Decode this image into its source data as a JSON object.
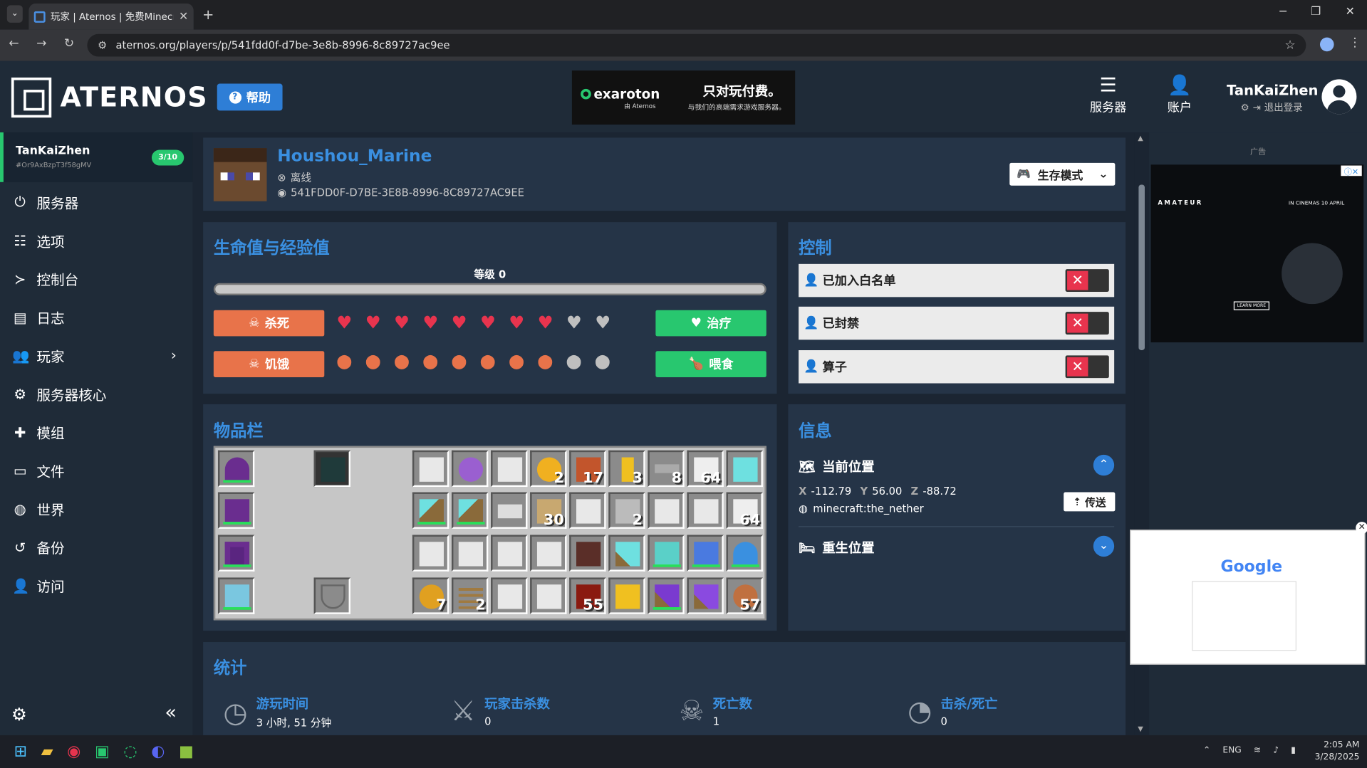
{
  "browser": {
    "tab_title": "玩家 | Aternos | 免费Minecraft服",
    "url": "aternos.org/players/p/541fdd0f-d7be-3e8b-8996-8c89727ac9ee"
  },
  "header": {
    "logo": "ATERNOS",
    "help": "帮助",
    "ad_brand": "exaroton",
    "ad_brand_sub": "由 Aternos",
    "ad_headline": "只对玩付费。",
    "ad_sub": "与我们的高端需求游戏服务器。",
    "nav_servers": "服务器",
    "nav_account": "账户",
    "username": "TanKaiZhen",
    "logout": "退出登录"
  },
  "sidebar": {
    "server_name": "TanKaiZhen",
    "server_id": "#Or9AxBzpT3f58gMV",
    "player_count": "3/10",
    "items": [
      {
        "label": "服务器",
        "icon": "power-icon"
      },
      {
        "label": "选项",
        "icon": "sliders-icon"
      },
      {
        "label": "控制台",
        "icon": "terminal-icon"
      },
      {
        "label": "日志",
        "icon": "file-icon"
      },
      {
        "label": "玩家",
        "icon": "users-icon"
      },
      {
        "label": "服务器核心",
        "icon": "cogs-icon"
      },
      {
        "label": "模组",
        "icon": "puzzle-icon"
      },
      {
        "label": "文件",
        "icon": "folder-icon"
      },
      {
        "label": "世界",
        "icon": "globe-icon"
      },
      {
        "label": "备份",
        "icon": "history-icon"
      },
      {
        "label": "访问",
        "icon": "user-lock-icon"
      }
    ]
  },
  "player": {
    "name": "Houshou_Marine",
    "status": "离线",
    "uuid": "541FDD0F-D7BE-3E8B-8996-8C89727AC9EE",
    "gamemode": "生存模式"
  },
  "health": {
    "title": "生命值与经验值",
    "level": "等级 0",
    "xp_progress": 0,
    "kill": "杀死",
    "starve": "饥饿",
    "heal": "治疗",
    "feed": "喂食",
    "hearts_full": 8,
    "hearts_total": 10,
    "food_full": 8,
    "food_total": 10
  },
  "control": {
    "title": "控制",
    "whitelisted": "已加入白名单",
    "banned": "已封禁",
    "op": "算子"
  },
  "inventory": {
    "title": "物品栏",
    "counts": {
      "apple": "2",
      "leather": "17",
      "nugget": "3",
      "key": "8",
      "snow": "64",
      "wheat": "30",
      "stone": "2",
      "quartz": "64",
      "redstone_block": "55",
      "melon": "7",
      "ladder": "2",
      "meat": "57"
    }
  },
  "info": {
    "title": "信息",
    "current_position": "当前位置",
    "x_label": "X",
    "x": "-112.79",
    "y_label": "Y",
    "y": "56.00",
    "z_label": "Z",
    "z": "-88.72",
    "world": "minecraft:the_nether",
    "teleport": "传送",
    "respawn": "重生位置"
  },
  "stats": {
    "title": "统计",
    "playtime_label": "游玩时间",
    "playtime": "3 小时, 51 分钟",
    "kills_label": "玩家击杀数",
    "kills": "0",
    "deaths_label": "死亡数",
    "deaths": "1",
    "kd_label": "击杀/死亡",
    "kd": "0"
  },
  "ads": {
    "label": "广告",
    "ad2_title": "AMATEUR",
    "ad2_sub": "IN CINEMAS 10 APRIL",
    "ad2_btn": "LEARN MORE",
    "pip_logo": "Google"
  },
  "taskbar": {
    "lang": "ENG",
    "time": "2:05 AM",
    "date": "3/28/2025"
  },
  "colors": {
    "accent": "#3a8fe0",
    "green": "#28c76f",
    "red": "#e8344e",
    "orange": "#e8734a",
    "panel": "#253447"
  }
}
